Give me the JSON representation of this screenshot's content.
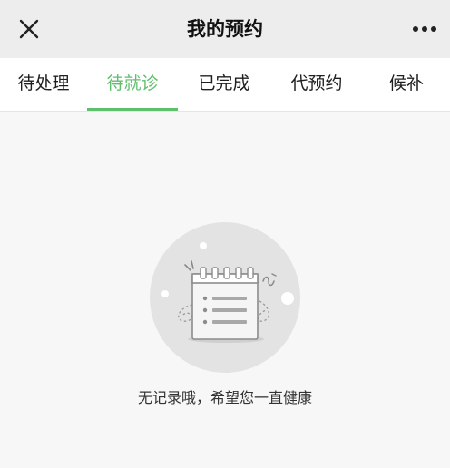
{
  "header": {
    "title": "我的预约",
    "close_icon": "close-icon",
    "more_icon": "more-horizontal-icon"
  },
  "tabs": [
    {
      "label": "待处理",
      "active": false
    },
    {
      "label": "待就诊",
      "active": true
    },
    {
      "label": "已完成",
      "active": false
    },
    {
      "label": "代预约",
      "active": false
    },
    {
      "label": "候补",
      "active": false
    }
  ],
  "empty_state": {
    "illustration_icon": "empty-calendar-notepad-icon",
    "message": "无记录哦，希望您一直健康"
  },
  "colors": {
    "accent": "#5ebf6c",
    "header_bg": "#ededed",
    "page_bg": "#f7f7f7",
    "illustration_circle": "#e3e3e3"
  }
}
